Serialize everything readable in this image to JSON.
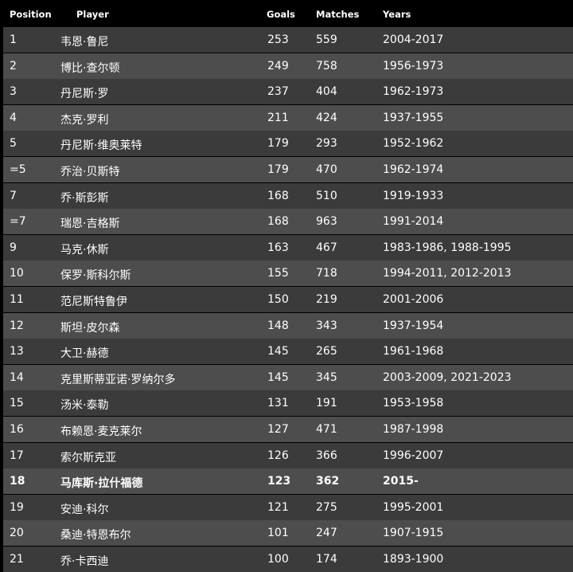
{
  "table": {
    "headers": {
      "position": "Position",
      "player": "Player",
      "goals": "Goals",
      "matches": "Matches",
      "years": "Years"
    },
    "rows": [
      {
        "position": "1",
        "player": "韦恩·鲁尼",
        "goals": "253",
        "matches": "559",
        "years": "2004-2017",
        "highlight": false
      },
      {
        "position": "2",
        "player": "博比·查尔顿",
        "goals": "249",
        "matches": "758",
        "years": "1956-1973",
        "highlight": false
      },
      {
        "position": "3",
        "player": "丹尼斯·罗",
        "goals": "237",
        "matches": "404",
        "years": "1962-1973",
        "highlight": false
      },
      {
        "position": "4",
        "player": "杰克·罗利",
        "goals": "211",
        "matches": "424",
        "years": "1937-1955",
        "highlight": false
      },
      {
        "position": "5",
        "player": "丹尼斯·维奥莱特",
        "goals": "179",
        "matches": "293",
        "years": "1952-1962",
        "highlight": false
      },
      {
        "position": "=5",
        "player": "乔治·贝斯特",
        "goals": "179",
        "matches": "470",
        "years": "1962-1974",
        "highlight": false
      },
      {
        "position": "7",
        "player": "乔·斯彭斯",
        "goals": "168",
        "matches": "510",
        "years": "1919-1933",
        "highlight": false
      },
      {
        "position": "=7",
        "player": "瑞恩·吉格斯",
        "goals": "168",
        "matches": "963",
        "years": "1991-2014",
        "highlight": false
      },
      {
        "position": "9",
        "player": "马克·休斯",
        "goals": "163",
        "matches": "467",
        "years": "1983-1986, 1988-1995",
        "highlight": false
      },
      {
        "position": "10",
        "player": "保罗·斯科尔斯",
        "goals": "155",
        "matches": "718",
        "years": "1994-2011, 2012-2013",
        "highlight": false
      },
      {
        "position": "11",
        "player": "范尼斯特鲁伊",
        "goals": "150",
        "matches": "219",
        "years": "2001-2006",
        "highlight": false
      },
      {
        "position": "12",
        "player": "斯坦·皮尔森",
        "goals": "148",
        "matches": "343",
        "years": "1937-1954",
        "highlight": false
      },
      {
        "position": "13",
        "player": "大卫·赫德",
        "goals": "145",
        "matches": "265",
        "years": "1961-1968",
        "highlight": false
      },
      {
        "position": "14",
        "player": "克里斯蒂亚诺·罗纳尔多",
        "goals": "145",
        "matches": "345",
        "years": "2003-2009, 2021-2023",
        "highlight": false
      },
      {
        "position": "15",
        "player": "汤米·泰勒",
        "goals": "131",
        "matches": "191",
        "years": "1953-1958",
        "highlight": false
      },
      {
        "position": "16",
        "player": "布赖恩·麦克莱尔",
        "goals": "127",
        "matches": "471",
        "years": "1987-1998",
        "highlight": false
      },
      {
        "position": "17",
        "player": "索尔斯克亚",
        "goals": "126",
        "matches": "366",
        "years": "1996-2007",
        "highlight": false
      },
      {
        "position": "18",
        "player": "马库斯·拉什福德",
        "goals": "123",
        "matches": "362",
        "years": "2015-",
        "highlight": true
      },
      {
        "position": "19",
        "player": "安迪·科尔",
        "goals": "121",
        "matches": "275",
        "years": "1995-2001",
        "highlight": false
      },
      {
        "position": "20",
        "player": "桑迪·特恩布尔",
        "goals": "101",
        "matches": "247",
        "years": "1907-1915",
        "highlight": false
      },
      {
        "position": "21",
        "player": "乔·卡西迪",
        "goals": "100",
        "matches": "174",
        "years": "1893-1900",
        "highlight": false
      }
    ]
  }
}
